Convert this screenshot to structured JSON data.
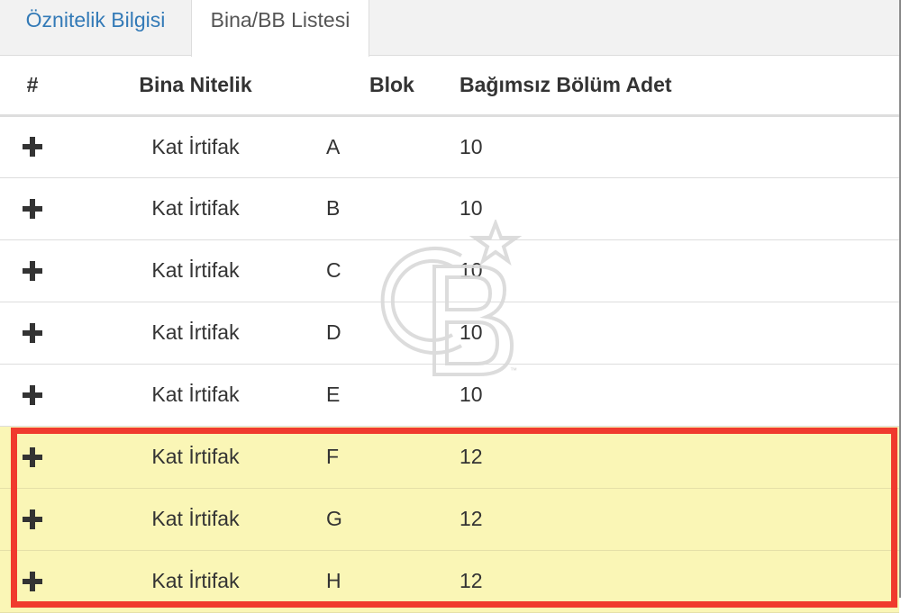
{
  "tabs": [
    {
      "label": "Öznitelik Bilgisi",
      "active": false
    },
    {
      "label": "Bina/BB Listesi",
      "active": true
    }
  ],
  "table": {
    "headers": {
      "hash": "#",
      "nitelik": "Bina Nitelik",
      "blok": "Blok",
      "adet": "Bağımsız Bölüm Adet"
    },
    "rows": [
      {
        "nitelik": "Kat İrtifak",
        "blok": "A",
        "adet": "10",
        "highlighted": false
      },
      {
        "nitelik": "Kat İrtifak",
        "blok": "B",
        "adet": "10",
        "highlighted": false
      },
      {
        "nitelik": "Kat İrtifak",
        "blok": "C",
        "adet": "10",
        "highlighted": false
      },
      {
        "nitelik": "Kat İrtifak",
        "blok": "D",
        "adet": "10",
        "highlighted": false
      },
      {
        "nitelik": "Kat İrtifak",
        "blok": "E",
        "adet": "10",
        "highlighted": false
      },
      {
        "nitelik": "Kat İrtifak",
        "blok": "F",
        "adet": "12",
        "highlighted": true
      },
      {
        "nitelik": "Kat İrtifak",
        "blok": "G",
        "adet": "12",
        "highlighted": true
      },
      {
        "nitelik": "Kat İrtifak",
        "blok": "H",
        "adet": "12",
        "highlighted": true
      }
    ],
    "expand_icon": "plus-icon"
  },
  "colors": {
    "tab_link": "#337ab7",
    "highlight_fill": "#faf6b6",
    "highlight_border": "#f03a2e"
  },
  "watermark": {
    "logo": "CB",
    "mark": "™"
  }
}
